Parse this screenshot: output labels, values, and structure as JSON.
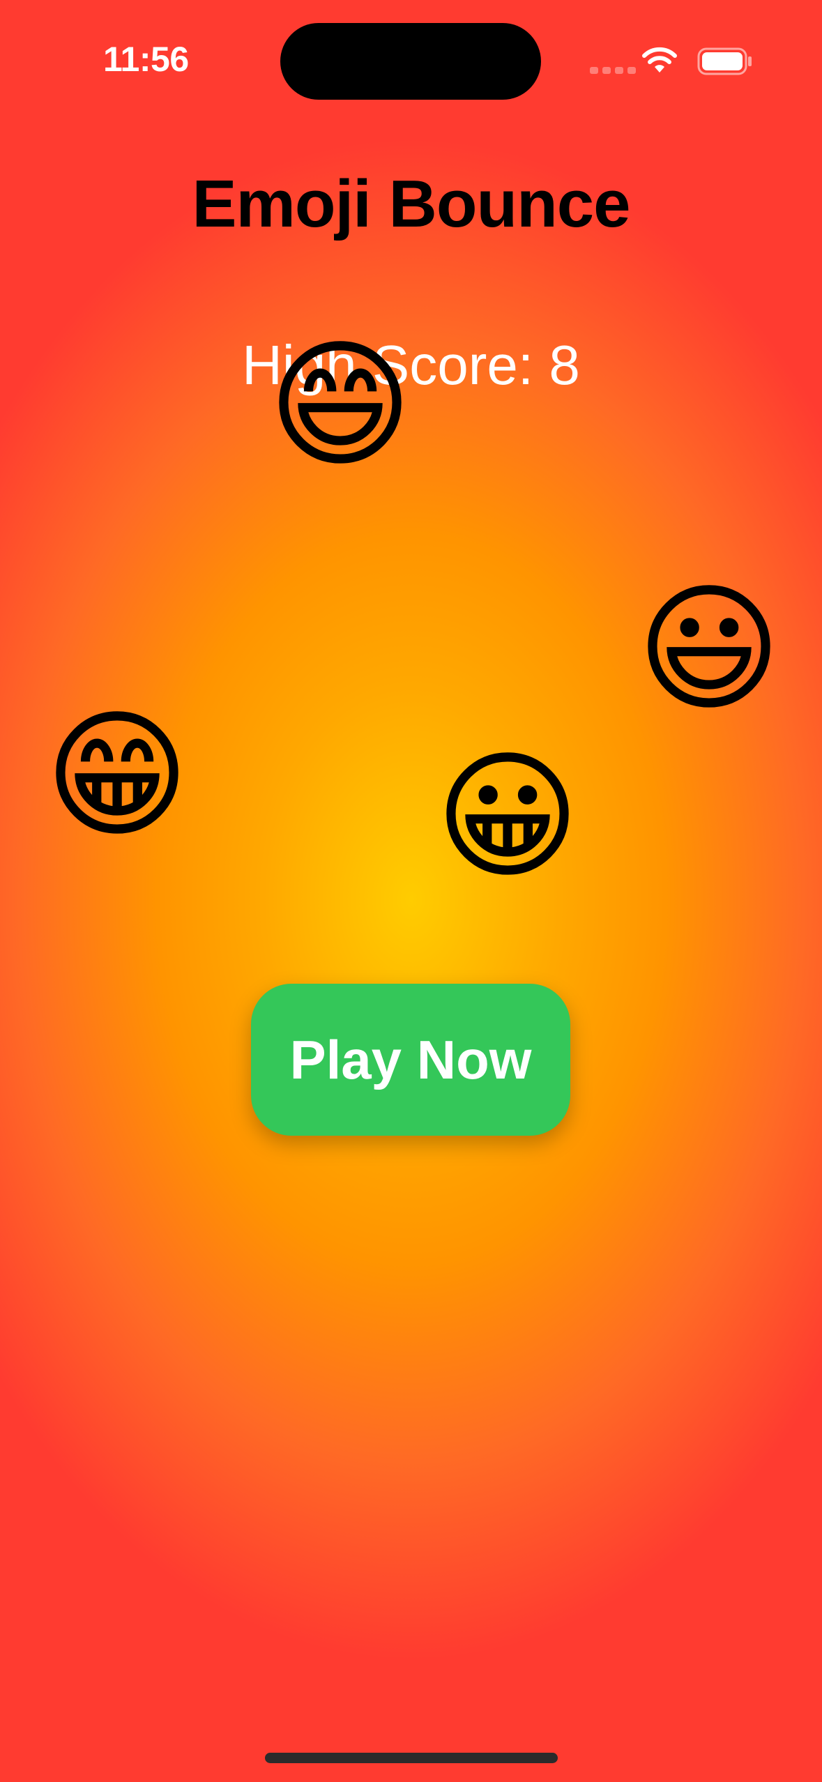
{
  "status_bar": {
    "time": "11:56",
    "icons": [
      "cellular-signal-icon",
      "wifi-icon",
      "battery-icon"
    ]
  },
  "title": "Emoji Bounce",
  "high_score": {
    "label": "High Score:",
    "value": "8"
  },
  "emojis": [
    "😄",
    "😃",
    "😁",
    "😀"
  ],
  "play_button": {
    "label": "Play Now"
  },
  "colors": {
    "background_center": "#ffcc00",
    "background_edge": "#ff3b30",
    "button": "#34c759",
    "title": "#000000",
    "score_text": "#ffffff"
  }
}
